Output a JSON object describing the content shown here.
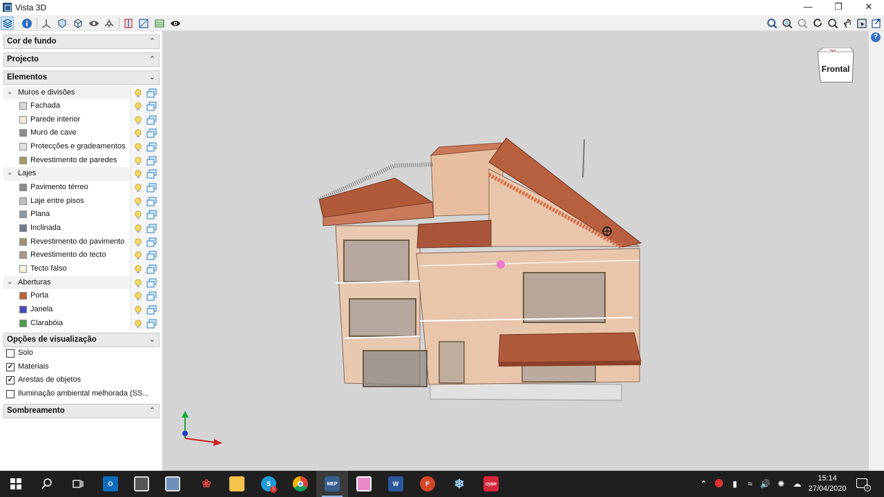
{
  "window": {
    "title": "Vista 3D"
  },
  "toolbar": {
    "left_icons": [
      "layers-icon",
      "info-icon",
      "axes-icon",
      "shield-view-icon",
      "cube-view-icon",
      "eye-cloud-icon",
      "orbit-icon",
      "section-icon",
      "box-icon",
      "floor-plan-icon",
      "visibility-icon"
    ],
    "right_icons": [
      "zoom-extents-icon",
      "zoom-window-icon",
      "zoom-in-icon",
      "rotate-icon",
      "zoom-icon",
      "pan-icon",
      "select-icon",
      "export-icon",
      "copy-icon"
    ]
  },
  "panel": {
    "sections": {
      "background": "Cor de fundo",
      "project": "Projecto",
      "elements": "Elementos",
      "view_options": "Opções de visualização",
      "shading": "Sombreamento"
    },
    "groups": [
      {
        "label": "Muros e divisões",
        "items": [
          {
            "label": "Fachada",
            "color": "#d9d9d9"
          },
          {
            "label": "Parede interior",
            "color": "#f5ead8"
          },
          {
            "label": "Muro de cave",
            "color": "#8c8c8c"
          },
          {
            "label": "Protecções e gradeamentos",
            "color": "#e0e0e0"
          },
          {
            "label": "Revestimento de paredes",
            "color": "#a8996c"
          }
        ]
      },
      {
        "label": "Lajes",
        "items": [
          {
            "label": "Pavimento térreo",
            "color": "#8a8a8a"
          },
          {
            "label": "Laje entre pisos",
            "color": "#bdbdbd"
          },
          {
            "label": "Plana",
            "color": "#8a9aab"
          },
          {
            "label": "Inclinada",
            "color": "#6e7b8a"
          },
          {
            "label": "Revestimento do pavimento",
            "color": "#a38f74"
          },
          {
            "label": "Revestimento do tecto",
            "color": "#a89886"
          },
          {
            "label": "Tecto falso",
            "color": "#f7efdc"
          }
        ]
      },
      {
        "label": "Aberturas",
        "items": [
          {
            "label": "Porta",
            "color": "#b8643a"
          },
          {
            "label": "Janela",
            "color": "#4a48b8"
          },
          {
            "label": "Clarabóia",
            "color": "#4f9a55"
          }
        ]
      }
    ],
    "options": [
      {
        "label": "Solo",
        "checked": false
      },
      {
        "label": "Materiais",
        "checked": true
      },
      {
        "label": "Arestas de objetos",
        "checked": true
      },
      {
        "label": "Iluminação ambiental melhorada (SS...",
        "checked": false
      }
    ]
  },
  "viewport": {
    "view_cube_label": "Frontal",
    "background": "#d4d4d4",
    "roof_color": "#b05a3c",
    "wall_color": "#e6c2a6"
  },
  "taskbar": {
    "apps": [
      "start-icon",
      "search-icon",
      "task-view-icon",
      "outlook-icon",
      "calculator-icon",
      "paint-icon",
      "cad-icon",
      "explorer-icon",
      "skype-icon",
      "chrome-icon",
      "mep-icon",
      "viewer-icon",
      "word-icon",
      "powerpoint-icon",
      "snowflake-icon",
      "cype-icon"
    ],
    "labels": {
      "outlook": "O",
      "word": "W",
      "powerpoint": "P",
      "mep": "MEP",
      "cype": "cype"
    },
    "skype_badge": "1",
    "time": "15:14",
    "date": "27/04/2020",
    "notifications": "1"
  }
}
